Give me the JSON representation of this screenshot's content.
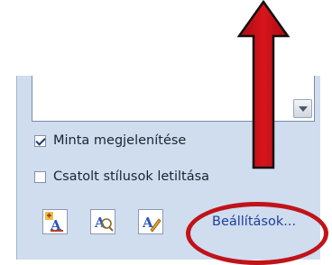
{
  "options": {
    "show_preview": {
      "label": "Minta megjelenítése",
      "checked": true
    },
    "linked_styles": {
      "label": "Csatolt stílusok letiltása",
      "checked": false
    }
  },
  "toolbar": {
    "new_style_icon": "new-style-icon",
    "style_inspector_icon": "style-inspector-icon",
    "manage_styles_icon": "manage-styles-icon"
  },
  "settings_link": "Beállítások...",
  "colors": {
    "callout": "#c0131a",
    "pane_bg": "#cfddef",
    "link": "#1e3f9a"
  }
}
